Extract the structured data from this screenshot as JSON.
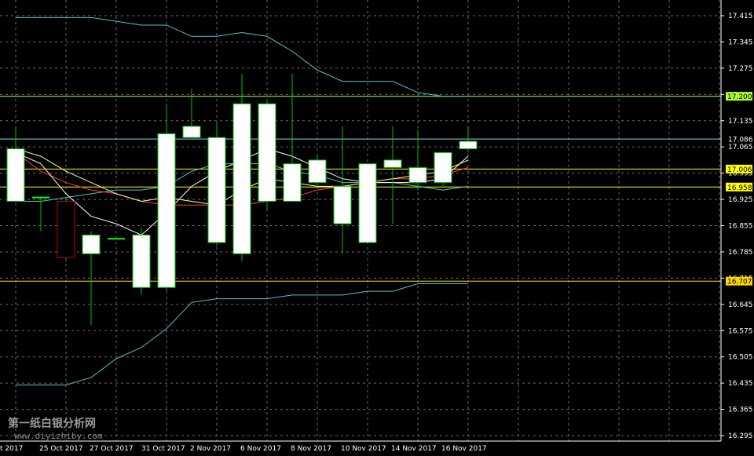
{
  "watermark": {
    "line1": "第一纸白银分析网",
    "line2": "www.diyizhiby.com"
  },
  "chart_data": {
    "type": "candlestick",
    "ylim": [
      16.295,
      17.415
    ],
    "y_ticks": [
      "17.415",
      "17.345",
      "17.275",
      "17.205",
      "17.135",
      "17.065",
      "16.995",
      "16.925",
      "16.855",
      "16.785",
      "16.715",
      "16.645",
      "16.575",
      "16.505",
      "16.435",
      "16.365",
      "16.295"
    ],
    "x_ticks": [
      "Oct 2017",
      "25 Oct 2017",
      "27 Oct 2017",
      "31 Oct 2017",
      "2 Nov 2017",
      "6 Nov 2017",
      "8 Nov 2017",
      "10 Nov 2017",
      "14 Nov 2017",
      "16 Nov 2017"
    ],
    "price_levels": [
      {
        "value": 17.2,
        "label": "17.200",
        "color": "#adff2f",
        "style": "solid",
        "box": true
      },
      {
        "value": 17.086,
        "label": "17.086",
        "color": "#87cefa",
        "style": "solid",
        "box": false
      },
      {
        "value": 17.006,
        "label": "17.006",
        "color": "#ffff00",
        "style": "solid",
        "box": true
      },
      {
        "value": 16.958,
        "label": "16.958",
        "color": "#ffff00",
        "style": "solid",
        "box": true
      },
      {
        "value": 16.707,
        "label": "16.707",
        "color": "#ffd700",
        "style": "solid",
        "box": true
      }
    ],
    "candles": [
      {
        "o": 16.92,
        "h": 17.12,
        "l": 16.92,
        "c": 17.06
      },
      {
        "o": 16.93,
        "h": 16.93,
        "l": 16.84,
        "c": 16.93
      },
      {
        "o": 16.92,
        "h": 16.93,
        "l": 16.76,
        "c": 16.77
      },
      {
        "o": 16.78,
        "h": 16.84,
        "l": 16.59,
        "c": 16.83
      },
      {
        "o": 16.82,
        "h": 16.82,
        "l": 16.82,
        "c": 16.82
      },
      {
        "o": 16.69,
        "h": 16.85,
        "l": 16.67,
        "c": 16.83
      },
      {
        "o": 16.69,
        "h": 17.18,
        "l": 16.68,
        "c": 17.1
      },
      {
        "o": 17.09,
        "h": 17.22,
        "l": 17.09,
        "c": 17.12
      },
      {
        "o": 16.81,
        "h": 17.13,
        "l": 16.8,
        "c": 17.09
      },
      {
        "o": 16.78,
        "h": 17.26,
        "l": 16.76,
        "c": 17.18
      },
      {
        "o": 16.92,
        "h": 17.19,
        "l": 16.9,
        "c": 17.18
      },
      {
        "o": 16.92,
        "h": 17.26,
        "l": 16.92,
        "c": 17.02
      },
      {
        "o": 16.97,
        "h": 17.04,
        "l": 16.96,
        "c": 17.03
      },
      {
        "o": 16.86,
        "h": 17.12,
        "l": 16.78,
        "c": 16.96
      },
      {
        "o": 16.81,
        "h": 17.02,
        "l": 16.81,
        "c": 17.02
      },
      {
        "o": 17.01,
        "h": 17.12,
        "l": 16.86,
        "c": 17.03
      },
      {
        "o": 16.97,
        "h": 17.11,
        "l": 16.95,
        "c": 17.01
      },
      {
        "o": 16.97,
        "h": 17.05,
        "l": 16.96,
        "c": 17.05
      },
      {
        "o": 17.06,
        "h": 17.12,
        "l": 17.05,
        "c": 17.08
      }
    ],
    "series": [
      {
        "color": "#4fc3c9",
        "values": [
          17.41,
          17.41,
          17.41,
          17.41,
          17.4,
          17.39,
          17.39,
          17.36,
          17.36,
          17.37,
          17.36,
          17.32,
          17.27,
          17.24,
          17.24,
          17.24,
          17.21,
          17.2,
          17.2
        ]
      },
      {
        "color": "#4fc3c9",
        "values": [
          16.43,
          16.43,
          16.43,
          16.45,
          16.5,
          16.53,
          16.58,
          16.65,
          16.66,
          16.66,
          16.66,
          16.67,
          16.67,
          16.67,
          16.68,
          16.68,
          16.7,
          16.7,
          16.7
        ]
      },
      {
        "color": "#4fc3c9",
        "values": [
          16.92,
          16.92,
          16.93,
          16.94,
          16.95,
          16.95,
          16.96,
          17.0,
          17.02,
          17.02,
          17.02,
          17.0,
          16.99,
          16.97,
          16.97,
          16.97,
          16.96,
          16.95,
          16.96
        ]
      },
      {
        "color": "#ff4040",
        "values": [
          17.05,
          17.0,
          16.97,
          16.95,
          16.94,
          16.92,
          16.91,
          16.91,
          16.91,
          16.91,
          16.92,
          16.93,
          16.95,
          16.96,
          16.97,
          16.98,
          16.98,
          16.99,
          17.01
        ]
      },
      {
        "color": "#ffff99",
        "values": [
          17.06,
          17.04,
          17.0,
          16.97,
          16.94,
          16.92,
          16.93,
          16.92,
          16.91,
          16.95,
          16.98,
          16.97,
          16.96,
          16.96,
          16.97,
          16.98,
          16.99,
          17.0,
          17.03
        ]
      },
      {
        "color": "#ffffff",
        "values": [
          17.05,
          17.02,
          16.94,
          16.88,
          16.86,
          16.83,
          16.89,
          16.96,
          17.0,
          17.03,
          17.06,
          17.04,
          17.01,
          16.98,
          16.97,
          16.97,
          16.97,
          16.98,
          17.04
        ]
      }
    ]
  }
}
